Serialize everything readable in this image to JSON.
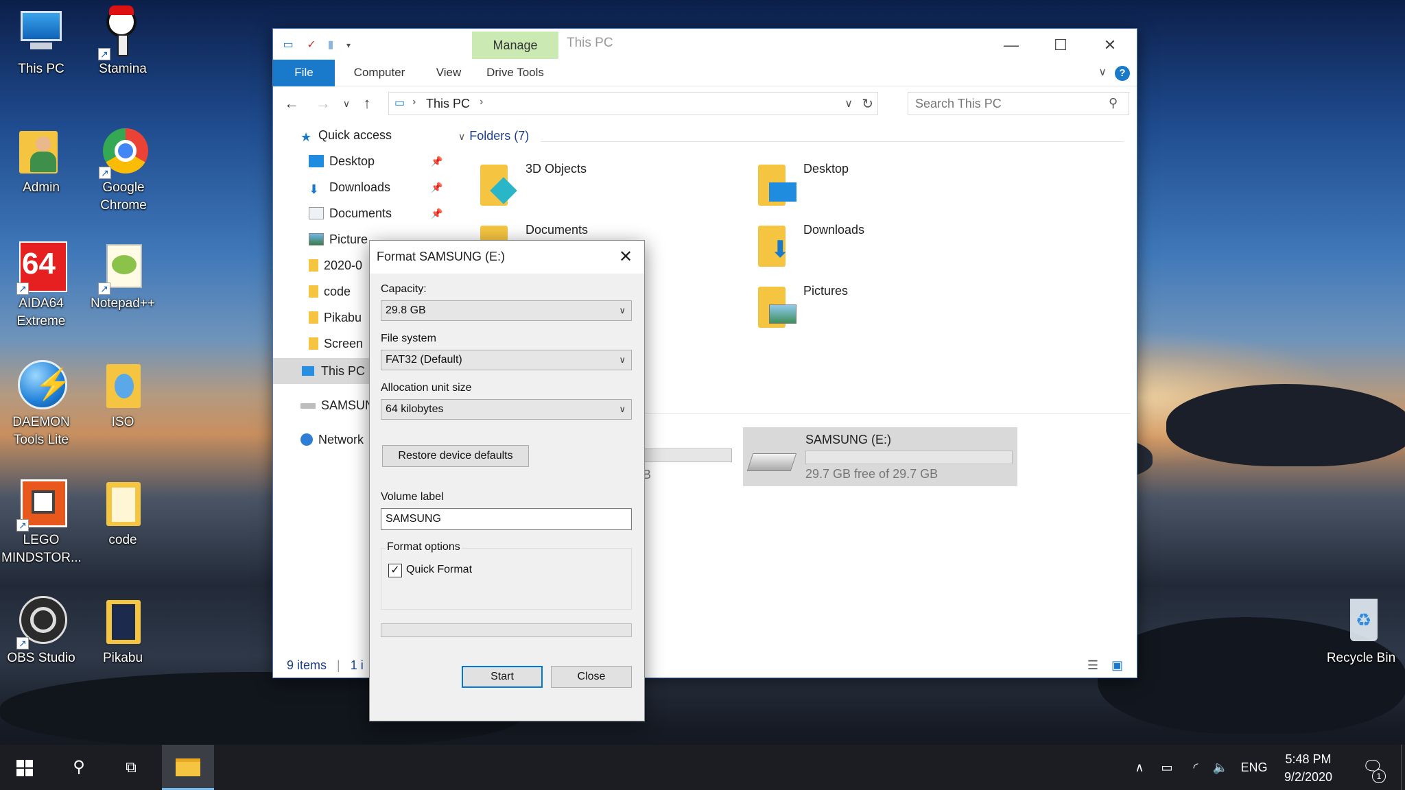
{
  "desktop": {
    "icons": [
      {
        "label": "This PC",
        "icon": "this-pc-icon"
      },
      {
        "label": "Stamina",
        "icon": "stamina-icon"
      },
      {
        "label": "Admin",
        "icon": "user-folder-icon"
      },
      {
        "label": "Google Chrome",
        "icon": "chrome-icon"
      },
      {
        "label": "AIDA64 Extreme",
        "icon": "aida64-icon"
      },
      {
        "label": "Notepad++",
        "icon": "notepadpp-icon"
      },
      {
        "label": "DAEMON Tools Lite",
        "icon": "daemon-tools-icon"
      },
      {
        "label": "ISO",
        "icon": "folder-icon"
      },
      {
        "label": "LEGO MINDSTOR...",
        "icon": "lego-icon"
      },
      {
        "label": "code",
        "icon": "folder-icon"
      },
      {
        "label": "OBS Studio",
        "icon": "obs-icon"
      },
      {
        "label": "Pikabu",
        "icon": "folder-icon"
      },
      {
        "label": "Recycle Bin",
        "icon": "recycle-bin-icon"
      }
    ]
  },
  "explorer": {
    "title": "This PC",
    "manage_tab": "Manage",
    "ribbon_tabs": [
      "File",
      "Computer",
      "View",
      "Drive Tools"
    ],
    "breadcrumb": "This PC",
    "search_placeholder": "Search This PC",
    "nav": {
      "quick_access": "Quick access",
      "items": [
        "Desktop",
        "Downloads",
        "Documents",
        "Picture",
        "2020-0",
        "code",
        "Pikabu",
        "Screen"
      ],
      "this_pc": "This PC",
      "samsung": "SAMSUN",
      "network": "Network"
    },
    "folders_header": "Folders (7)",
    "folders": [
      "3D Objects",
      "Desktop",
      "Documents",
      "Downloads",
      "Pictures"
    ],
    "drive_partial_text": "B",
    "drive": {
      "name": "SAMSUNG (E:)",
      "free_text": "29.7 GB free of 29.7 GB",
      "used_fraction": 0.0
    },
    "status": {
      "items": "9 items",
      "selected": "1 i"
    }
  },
  "format_dialog": {
    "title": "Format SAMSUNG (E:)",
    "capacity_label": "Capacity:",
    "capacity_value": "29.8 GB",
    "fs_label": "File system",
    "fs_value": "FAT32 (Default)",
    "alloc_label": "Allocation unit size",
    "alloc_value": "64 kilobytes",
    "restore_button": "Restore device defaults",
    "volume_label": "Volume label",
    "volume_value": "SAMSUNG",
    "format_options": "Format options",
    "quick_format": "Quick Format",
    "quick_format_checked": true,
    "progress": 0.0,
    "start_button": "Start",
    "close_button": "Close"
  },
  "taskbar": {
    "language": "ENG",
    "time": "5:48 PM",
    "date": "9/2/2020",
    "notification_count": "1"
  }
}
